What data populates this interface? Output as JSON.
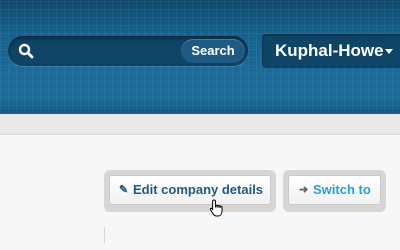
{
  "header": {
    "search": {
      "placeholder": "",
      "button_label": "Search"
    },
    "company": {
      "name": "Kuphal-Howe"
    }
  },
  "actions": {
    "edit_label": "Edit company details",
    "switch_label": "Switch to"
  },
  "icons": {
    "search": "search-icon",
    "edit": "pencil-icon",
    "switch": "arrow-right-icon",
    "caret": "caret-down-icon",
    "cursor": "hand-pointer-icon"
  },
  "colors": {
    "header_blue": "#1b6a98",
    "edit_text": "#1f5a82",
    "switch_text": "#2a9fd8"
  }
}
